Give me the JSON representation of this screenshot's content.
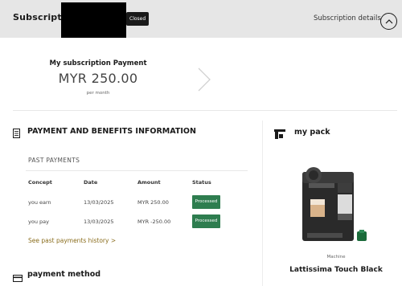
{
  "header": {
    "title": "Subscriptio",
    "badge": "Closed",
    "details_link": "Subscription details",
    "details_icon": "chevron-up-icon"
  },
  "payment": {
    "label": "My subscription Payment",
    "amount": "MYR 250.00",
    "period": "per month",
    "next_icon": "chevron-right-icon"
  },
  "benefits": {
    "title": "PAYMENT AND BENEFITS INFORMATION",
    "icon": "document-icon",
    "past_payments": {
      "title": "PAST PAYMENTS",
      "columns": [
        "Concept",
        "Date",
        "Amount",
        "Status"
      ],
      "rows": [
        {
          "concept": "you earn",
          "date": "13/03/2025",
          "amount": "MYR 250.00",
          "status": "Processed"
        },
        {
          "concept": "you pay",
          "date": "13/03/2025",
          "amount": "MYR -250.00",
          "status": "Processed"
        }
      ],
      "history_link": "See past payments history >"
    }
  },
  "pack": {
    "title": "my pack",
    "icon": "machine-icon",
    "product_category": "Machine",
    "product_name": "Lattissima Touch Black"
  },
  "payment_method": {
    "title": "payment method",
    "icon": "card-icon"
  },
  "colors": {
    "header_bg": "#e6e6e6",
    "status_green": "#2e7d4f",
    "link_gold": "#8a6d1d"
  }
}
